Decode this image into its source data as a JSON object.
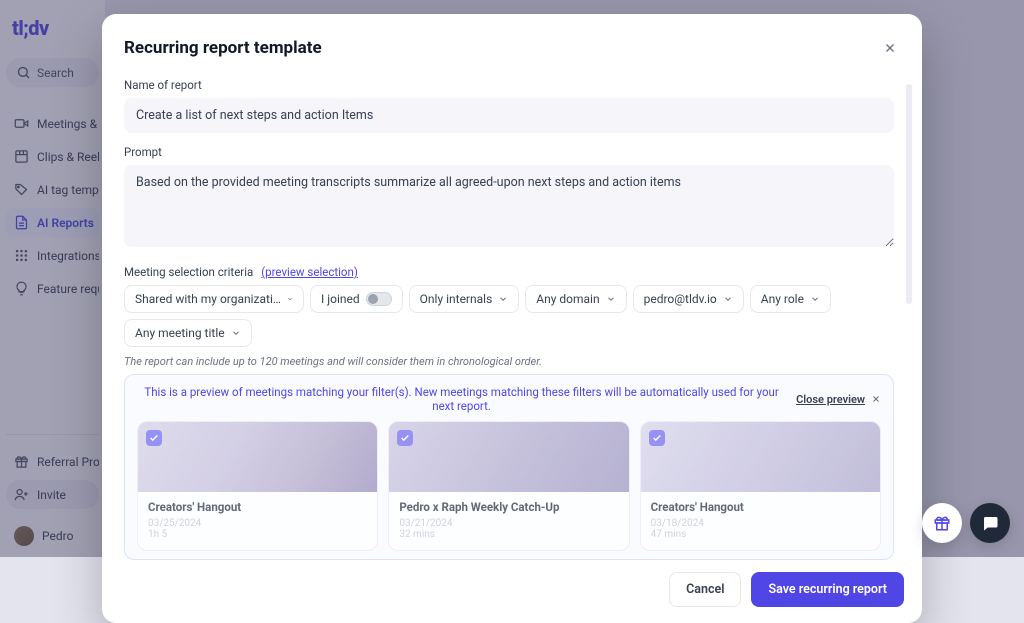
{
  "brand": "tl;dv",
  "search_label": "Search",
  "sidebar": {
    "items": [
      {
        "label": "Meetings & Fi"
      },
      {
        "label": "Clips & Reels"
      },
      {
        "label": "AI tag templ"
      },
      {
        "label": "AI Reports"
      },
      {
        "label": "Integrations"
      },
      {
        "label": "Feature requ"
      }
    ],
    "referral": "Referral Prog",
    "invite": "Invite",
    "user": "Pedro"
  },
  "modal": {
    "title": "Recurring report template",
    "name_label": "Name of report",
    "name_value": "Create a list of next steps and action Items",
    "prompt_label": "Prompt",
    "prompt_value": "Based on the provided meeting transcripts summarize all agreed-upon next steps and action items",
    "criteria_label": "Meeting selection criteria",
    "preview_link": "(preview selection)",
    "criteria": {
      "sharing": "Shared with my organizati…",
      "join": "I joined",
      "internal": "Only internals",
      "domain": "Any domain",
      "email": "pedro@tldv.io",
      "role": "Any role",
      "title": "Any meeting title"
    },
    "helper": "The report can include up to 120 meetings and will consider them in chronological order.",
    "banner_text": "This is a preview of meetings matching your filter(s). New meetings matching these filters will be automatically used for your next report.",
    "close_preview": "Close preview",
    "cards": [
      {
        "title": "Creators' Hangout",
        "date": "03/25/2024",
        "duration": "1h 5"
      },
      {
        "title": "Pedro x Raph Weekly Catch-Up",
        "date": "03/21/2024",
        "duration": "32 mins"
      },
      {
        "title": "Creators' Hangout",
        "date": "03/18/2024",
        "duration": "47 mins"
      }
    ],
    "cancel": "Cancel",
    "save": "Save recurring report"
  }
}
